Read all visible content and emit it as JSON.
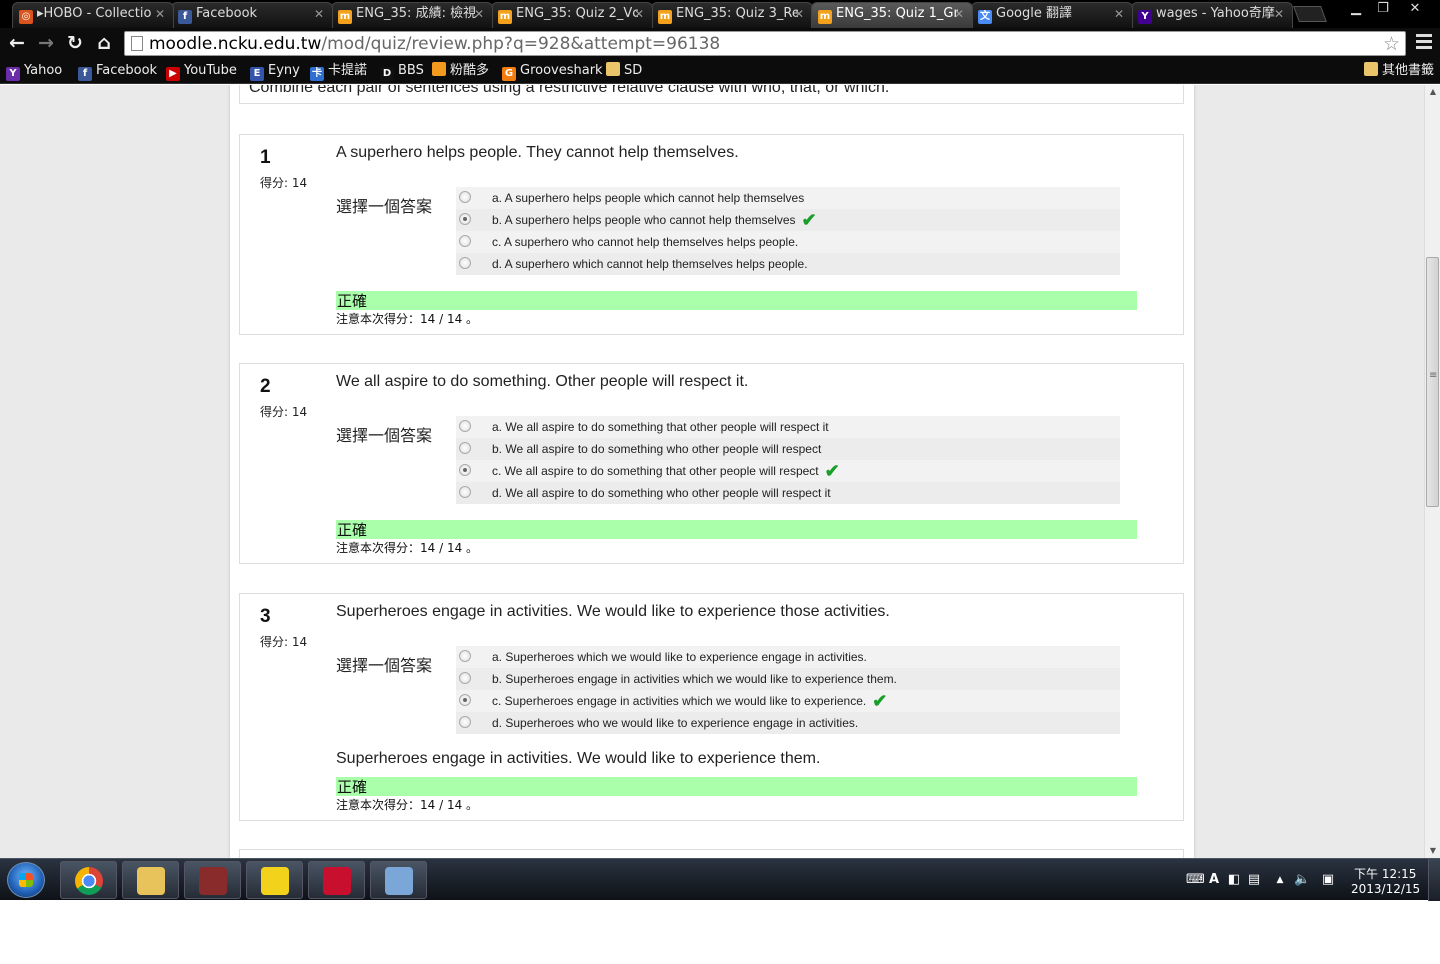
{
  "tabs": [
    {
      "title": "▸HOBO - Collectio",
      "icon": "hobo-icon",
      "color": "#d9541e",
      "glyph": "◎"
    },
    {
      "title": "Facebook",
      "icon": "facebook-icon",
      "color": "#3b5998",
      "glyph": "f"
    },
    {
      "title": "ENG_35: 成績: 檢視",
      "icon": "moodle-icon",
      "color": "#f3a11b",
      "glyph": "m"
    },
    {
      "title": "ENG_35: Quiz 2_Vc",
      "icon": "moodle-icon",
      "color": "#f3a11b",
      "glyph": "m"
    },
    {
      "title": "ENG_35: Quiz 3_Re",
      "icon": "moodle-icon",
      "color": "#f3a11b",
      "glyph": "m"
    },
    {
      "title": "ENG_35: Quiz 1_Gr",
      "icon": "moodle-icon",
      "color": "#f3a11b",
      "glyph": "m",
      "active": true
    },
    {
      "title": "Google 翻譯",
      "icon": "google-translate-icon",
      "color": "#4a8af4",
      "glyph": "文"
    },
    {
      "title": "wages - Yahoo奇摩",
      "icon": "yahoo-icon",
      "color": "#400090",
      "glyph": "Y"
    }
  ],
  "toolbar": {
    "url_host": "moodle.ncku.edu.tw",
    "url_path": "/mod/quiz/review.php?q=928&attempt=96138"
  },
  "bookmarks": [
    {
      "label": "Yahoo",
      "icon": "yahoo-icon",
      "color": "#6b2ea8",
      "glyph": "Y"
    },
    {
      "label": "Facebook",
      "icon": "facebook-icon",
      "color": "#3b5998",
      "glyph": "f"
    },
    {
      "label": "YouTube",
      "icon": "youtube-icon",
      "color": "#cc0000",
      "glyph": "▶"
    },
    {
      "label": "Eyny",
      "icon": "eyny-icon",
      "color": "#3355aa",
      "glyph": "E"
    },
    {
      "label": "卡提諾",
      "icon": "ck101-icon",
      "color": "#2e6fd1",
      "glyph": "卡"
    },
    {
      "label": "BBS",
      "icon": "bbs-icon",
      "color": "#111111",
      "glyph": "D"
    },
    {
      "label": "粉酷多",
      "icon": "fankuduo-icon",
      "color": "#f39a1e",
      "glyph": ""
    },
    {
      "label": "Grooveshark",
      "icon": "grooveshark-icon",
      "color": "#f27d0c",
      "glyph": "G"
    },
    {
      "label": "SD",
      "icon": "folder-icon",
      "color": "#e9c46a",
      "glyph": ""
    }
  ],
  "other_bookmarks": "其他書籤",
  "page": {
    "intro": "Combine each pair of sentences using a restrictive relative clause with who, that, or which."
  },
  "questions": [
    {
      "number": "1",
      "score": "得分: 14",
      "text": "A superhero helps people. They cannot help themselves.",
      "prompt": "選擇一個答案",
      "answers": [
        {
          "text": "a. A superhero helps people which cannot help themselves",
          "selected": false,
          "correct": false
        },
        {
          "text": "b. A superhero helps people who cannot help themselves",
          "selected": true,
          "correct": true
        },
        {
          "text": "c. A superhero who cannot help themselves helps people.",
          "selected": false,
          "correct": false
        },
        {
          "text": "d. A superhero which cannot help themselves helps people.",
          "selected": false,
          "correct": false
        }
      ],
      "feedback": "",
      "result": "正確",
      "note": "注意本次得分：14 / 14 。"
    },
    {
      "number": "2",
      "score": "得分: 14",
      "text": "We all aspire to do something. Other people will respect it.",
      "prompt": "選擇一個答案",
      "answers": [
        {
          "text": "a. We all aspire to do something that other people will respect it",
          "selected": false,
          "correct": false
        },
        {
          "text": "b. We all aspire to do something who other people will respect",
          "selected": false,
          "correct": false
        },
        {
          "text": "c. We all aspire to do something that other people will respect",
          "selected": true,
          "correct": true
        },
        {
          "text": "d. We all aspire to do something who other people will respect it",
          "selected": false,
          "correct": false
        }
      ],
      "feedback": "",
      "result": "正確",
      "note": "注意本次得分：14 / 14 。"
    },
    {
      "number": "3",
      "score": "得分: 14",
      "text": "Superheroes engage in activities. We would like to experience those activities.",
      "prompt": "選擇一個答案",
      "answers": [
        {
          "text": "a. Superheroes which we would like to experience engage in activities.",
          "selected": false,
          "correct": false
        },
        {
          "text": "b. Superheroes engage in activities which we would like to experience them.",
          "selected": false,
          "correct": false
        },
        {
          "text": "c. Superheroes engage in activities which we would like to experience.",
          "selected": true,
          "correct": true
        },
        {
          "text": "d. Superheroes who we would like to experience engage in activities.",
          "selected": false,
          "correct": false
        }
      ],
      "feedback": "Superheroes engage in activities. We would like to experience them.",
      "result": "正確",
      "note": "注意本次得分：14 / 14 。"
    }
  ],
  "taskbar": {
    "apps": [
      {
        "name": "chrome-taskbar-icon",
        "color": "#dd4b39"
      },
      {
        "name": "explorer-taskbar-icon",
        "color": "#e8c25a"
      },
      {
        "name": "game-taskbar-icon",
        "color": "#8a2b2b"
      },
      {
        "name": "kakao-taskbar-icon",
        "color": "#f2d21b"
      },
      {
        "name": "acrobat-taskbar-icon",
        "color": "#c8102e"
      },
      {
        "name": "paint-taskbar-icon",
        "color": "#7aa6d8"
      }
    ],
    "clock_time": "下午 12:15",
    "clock_date": "2013/12/15"
  }
}
